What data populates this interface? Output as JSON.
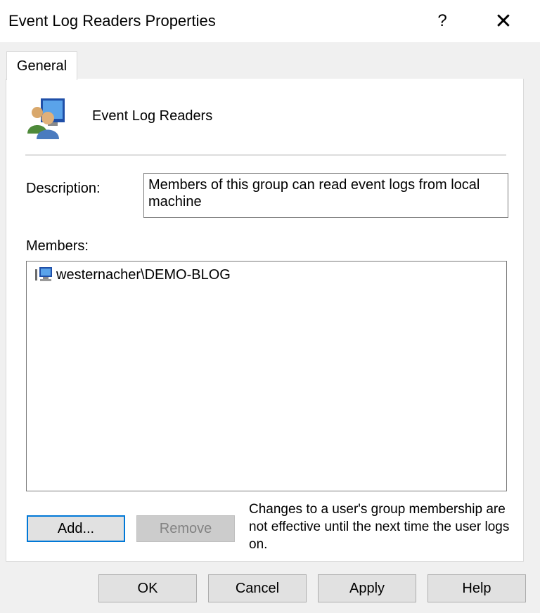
{
  "window": {
    "title": "Event Log Readers Properties",
    "help_glyph": "?",
    "close_glyph": "✕"
  },
  "tabs": [
    {
      "label": "General",
      "selected": true
    }
  ],
  "general": {
    "group_name": "Event Log Readers",
    "icon": "users-group-icon",
    "description_label": "Description:",
    "description_value": "Members of this group can read event logs from local machine",
    "members_label": "Members:",
    "members": [
      {
        "name": "westernacher\\DEMO-BLOG",
        "icon": "computer-account-icon"
      }
    ],
    "add_label": "Add...",
    "remove_label": "Remove",
    "note": "Changes to a user's group membership are not effective until the next time the user logs on."
  },
  "footer": {
    "ok_label": "OK",
    "cancel_label": "Cancel",
    "apply_label": "Apply",
    "help_label": "Help"
  },
  "colors": {
    "focus_border": "#0078d7",
    "button_face": "#e1e1e1",
    "dialog_background": "#f0f0f0"
  }
}
